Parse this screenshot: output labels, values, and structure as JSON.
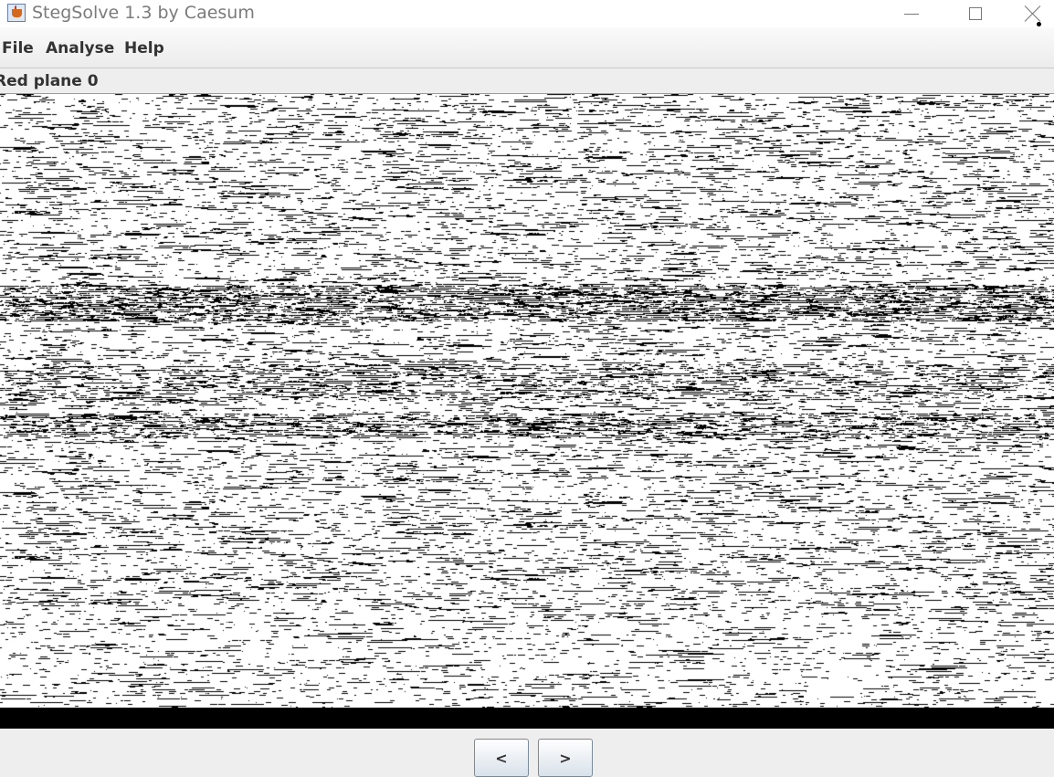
{
  "window": {
    "title": "StegSolve 1.3 by Caesum",
    "icon": "java-cup-icon",
    "controls": [
      "minimize-icon",
      "maximize-icon",
      "close-icon"
    ]
  },
  "menu": {
    "file": "File",
    "analyse": "Analyse",
    "help": "Help"
  },
  "view": {
    "plane_label": "Red plane 0",
    "image": "bit-plane-noise-image"
  },
  "nav": {
    "prev": "<",
    "next": ">"
  },
  "colors": {
    "background": "#eeeeee",
    "plane_white": "#ffffff",
    "plane_black": "#000000"
  }
}
